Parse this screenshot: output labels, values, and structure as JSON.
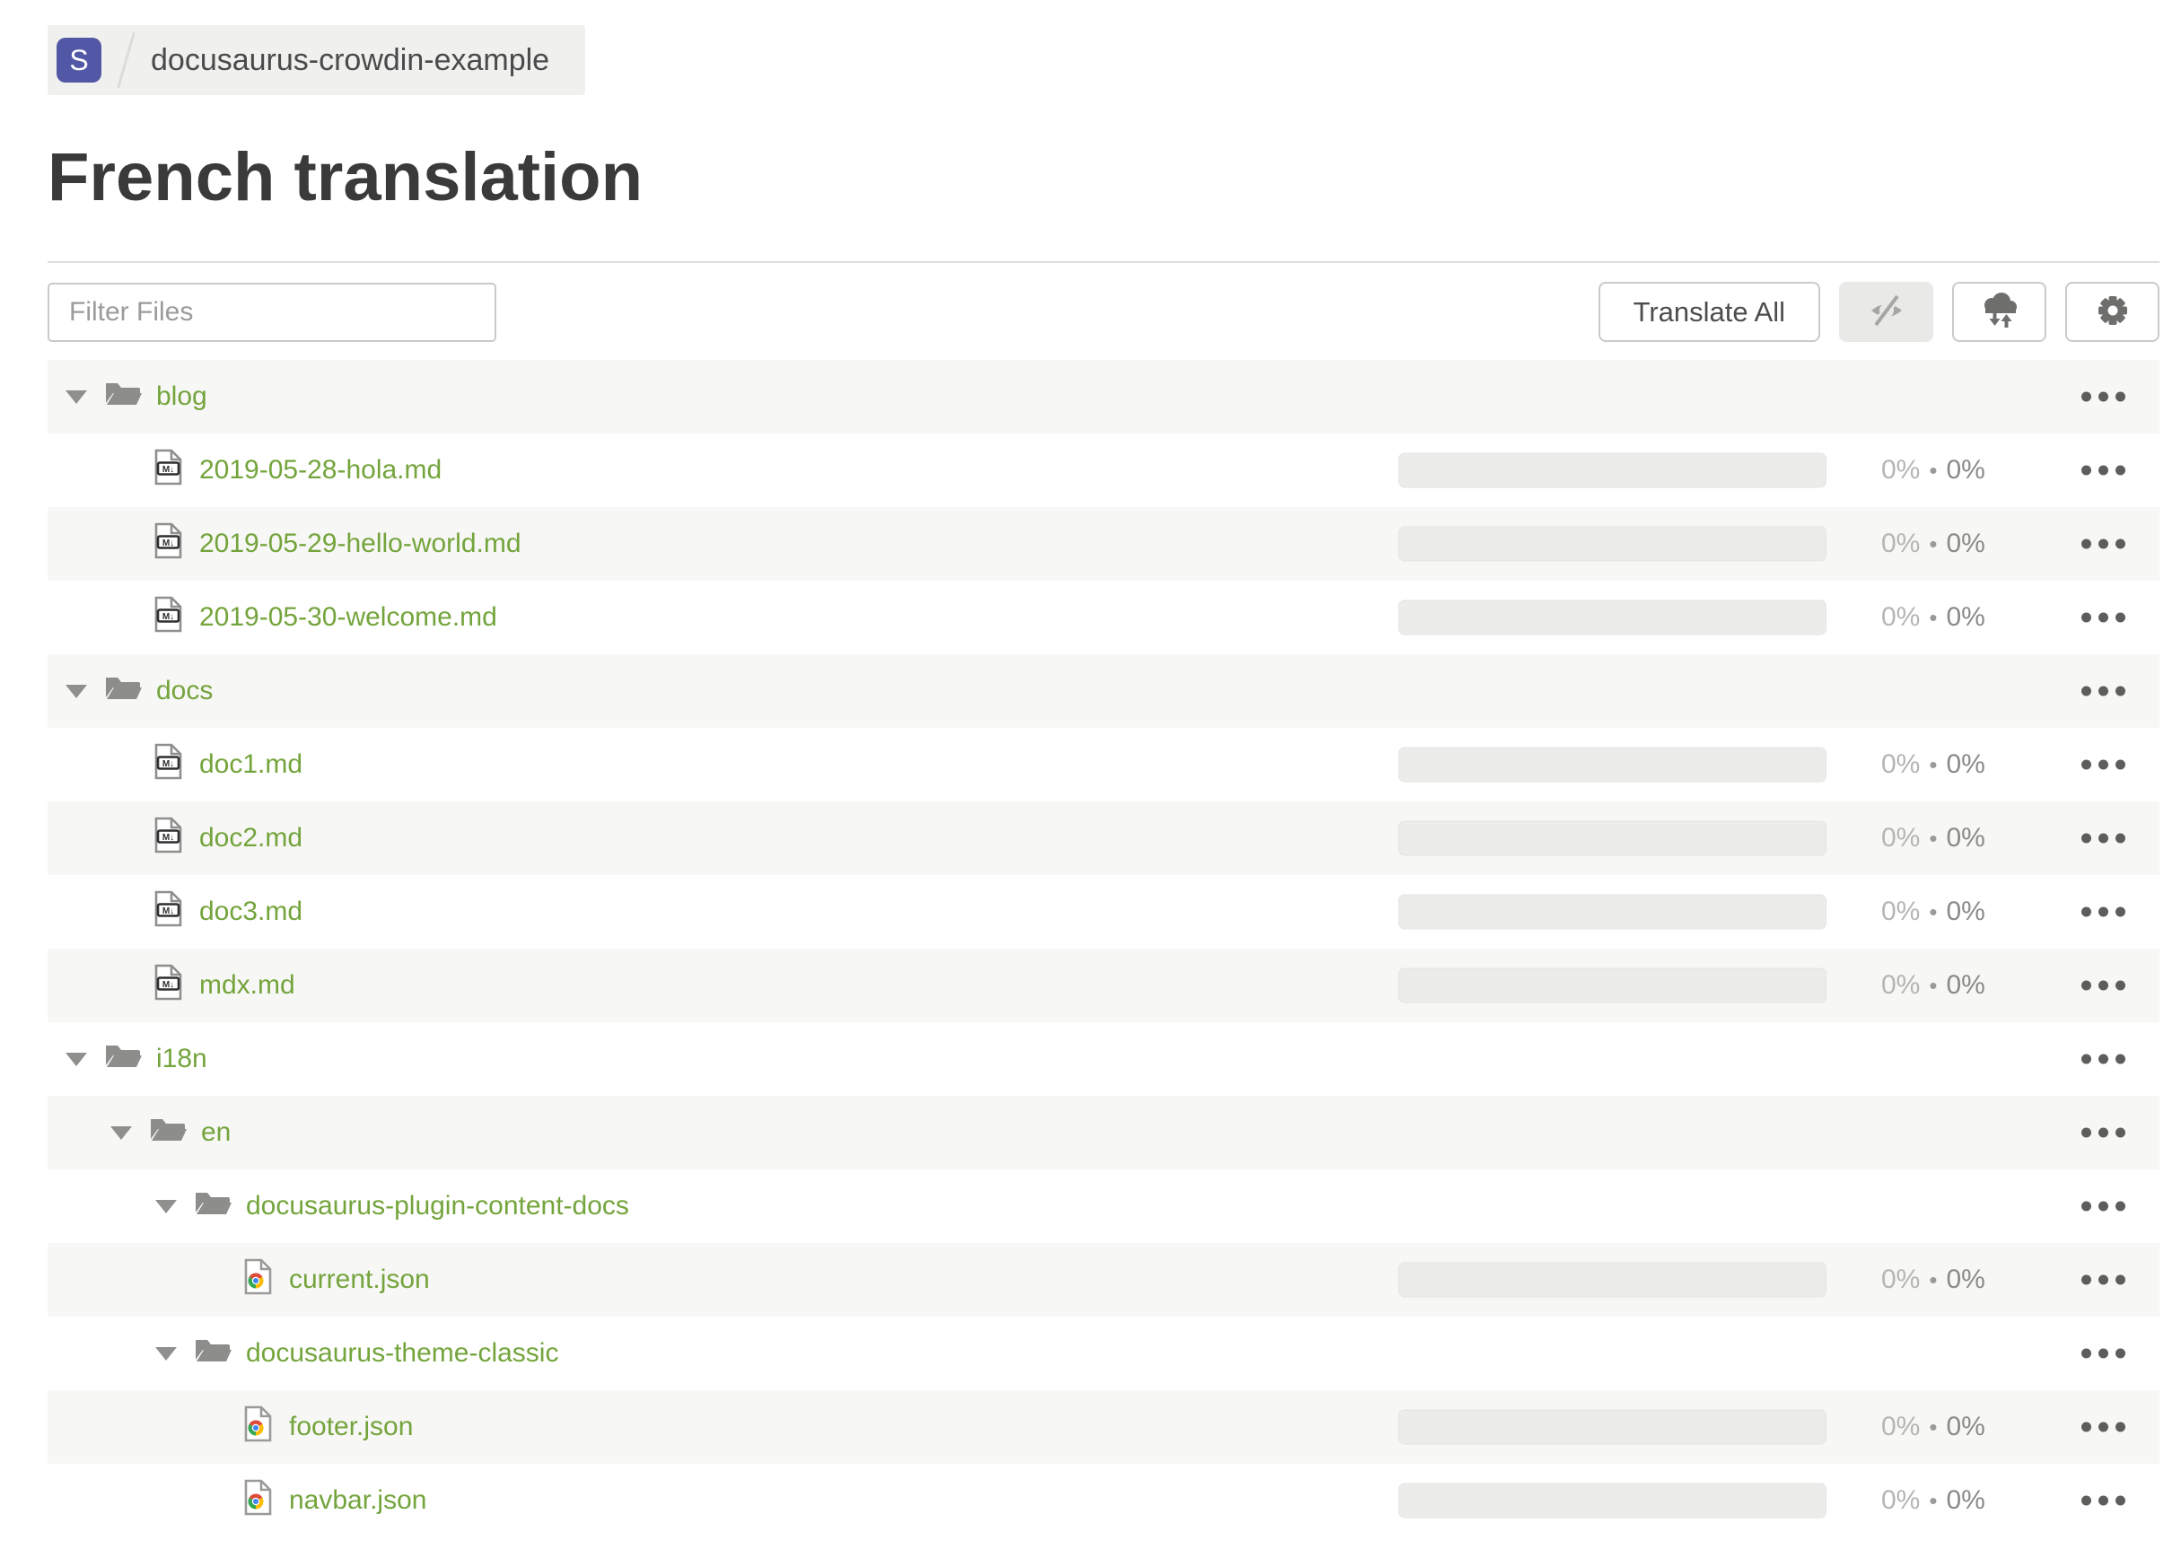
{
  "breadcrumb": {
    "logo_letter": "S",
    "project_name": "docusaurus-crowdin-example"
  },
  "page": {
    "title": "French translation"
  },
  "toolbar": {
    "filter_placeholder": "Filter Files",
    "translate_all_label": "Translate All",
    "icon_buttons": [
      {
        "name": "hide-completed",
        "icon": "eye-off-icon",
        "active": true
      },
      {
        "name": "sync",
        "icon": "cloud-download-upload-icon",
        "active": false
      },
      {
        "name": "settings",
        "icon": "gear-icon",
        "active": false
      }
    ]
  },
  "colors": {
    "link_green": "#74a43c",
    "badge_purple": "#5358a6",
    "row_stripe": "#f7f7f5",
    "icon_grey": "#6e6e6c",
    "folder_grey": "#8d8d8b"
  },
  "tree": {
    "rows": [
      {
        "kind": "folder",
        "level": 0,
        "label": "blog",
        "icon": "folder"
      },
      {
        "kind": "file",
        "level": 1,
        "label": "2019-05-28-hola.md",
        "icon": "markdown",
        "translated": "0%",
        "approved": "0%"
      },
      {
        "kind": "file",
        "level": 1,
        "label": "2019-05-29-hello-world.md",
        "icon": "markdown",
        "translated": "0%",
        "approved": "0%"
      },
      {
        "kind": "file",
        "level": 1,
        "label": "2019-05-30-welcome.md",
        "icon": "markdown",
        "translated": "0%",
        "approved": "0%"
      },
      {
        "kind": "folder",
        "level": 0,
        "label": "docs",
        "icon": "folder"
      },
      {
        "kind": "file",
        "level": 1,
        "label": "doc1.md",
        "icon": "markdown",
        "translated": "0%",
        "approved": "0%"
      },
      {
        "kind": "file",
        "level": 1,
        "label": "doc2.md",
        "icon": "markdown",
        "translated": "0%",
        "approved": "0%"
      },
      {
        "kind": "file",
        "level": 1,
        "label": "doc3.md",
        "icon": "markdown",
        "translated": "0%",
        "approved": "0%"
      },
      {
        "kind": "file",
        "level": 1,
        "label": "mdx.md",
        "icon": "markdown",
        "translated": "0%",
        "approved": "0%"
      },
      {
        "kind": "folder",
        "level": 0,
        "label": "i18n",
        "icon": "folder"
      },
      {
        "kind": "folder",
        "level": 1,
        "label": "en",
        "icon": "folder"
      },
      {
        "kind": "folder",
        "level": 2,
        "label": "docusaurus-plugin-content-docs",
        "icon": "folder"
      },
      {
        "kind": "file",
        "level": 3,
        "label": "current.json",
        "icon": "json",
        "translated": "0%",
        "approved": "0%"
      },
      {
        "kind": "folder",
        "level": 2,
        "label": "docusaurus-theme-classic",
        "icon": "folder"
      },
      {
        "kind": "file",
        "level": 3,
        "label": "footer.json",
        "icon": "json",
        "translated": "0%",
        "approved": "0%"
      },
      {
        "kind": "file",
        "level": 3,
        "label": "navbar.json",
        "icon": "json",
        "translated": "0%",
        "approved": "0%"
      }
    ]
  }
}
